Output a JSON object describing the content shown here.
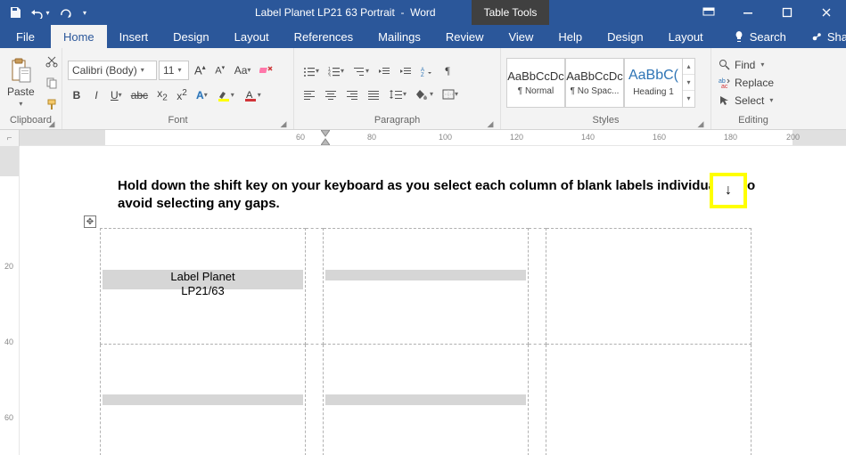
{
  "title": {
    "doc": "Label Planet LP21 63 Portrait",
    "app": "Word",
    "context_group": "Table Tools"
  },
  "tabs": {
    "file": "File",
    "home": "Home",
    "insert": "Insert",
    "design": "Design",
    "layout": "Layout",
    "references": "References",
    "mailings": "Mailings",
    "review": "Review",
    "view": "View",
    "help": "Help",
    "tt_design": "Design",
    "tt_layout": "Layout",
    "search": "Search",
    "share": "Share"
  },
  "clipboard": {
    "paste": "Paste",
    "label": "Clipboard"
  },
  "font": {
    "name": "Calibri (Body)",
    "size": "11",
    "label": "Font"
  },
  "paragraph": {
    "label": "Paragraph"
  },
  "styles": {
    "preview": "AaBbCcDc",
    "s1": "¶ Normal",
    "s2": "¶ No Spac...",
    "s3": "Heading 1",
    "preview3": "AaBbC(",
    "label": "Styles"
  },
  "editing": {
    "find": "Find",
    "replace": "Replace",
    "select": "Select",
    "label": "Editing"
  },
  "ruler": {
    "marks": [
      "60",
      "80",
      "100",
      "120",
      "140",
      "160",
      "180",
      "200"
    ]
  },
  "vruler": {
    "marks": [
      "20",
      "40",
      "60"
    ]
  },
  "doc": {
    "instruction": "Hold down the shift key on your keyboard as you select each column of blank labels individually - to avoid selecting any gaps.",
    "cell_line1": "Label Planet",
    "cell_line2": "LP21/63",
    "arrow": "↓"
  }
}
